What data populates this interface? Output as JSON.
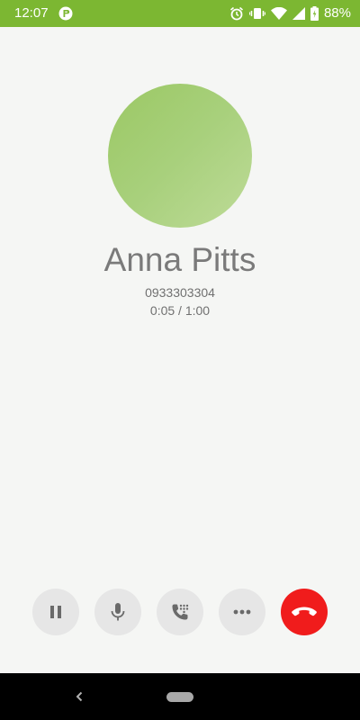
{
  "status_bar": {
    "time": "12:07",
    "battery": "88%",
    "background_color": "#7cb732",
    "icons": [
      "app-notification-icon",
      "alarm-icon",
      "vibrate-icon",
      "wifi-icon",
      "cell-signal-icon",
      "battery-icon"
    ]
  },
  "call": {
    "avatar_color": "#a8d07c",
    "name": "Anna Pitts",
    "number": "0933303304",
    "timer": "0:05 / 1:00"
  },
  "actions": [
    {
      "name": "pause",
      "icon": "pause-icon"
    },
    {
      "name": "mute",
      "icon": "microphone-icon"
    },
    {
      "name": "dialpad",
      "icon": "dialpad-call-icon"
    },
    {
      "name": "more",
      "icon": "more-dots-icon"
    },
    {
      "name": "end-call",
      "icon": "hang-up-icon",
      "color": "#f01c1c"
    }
  ],
  "nav": {
    "icons": [
      "back-icon",
      "home-pill-icon"
    ]
  }
}
